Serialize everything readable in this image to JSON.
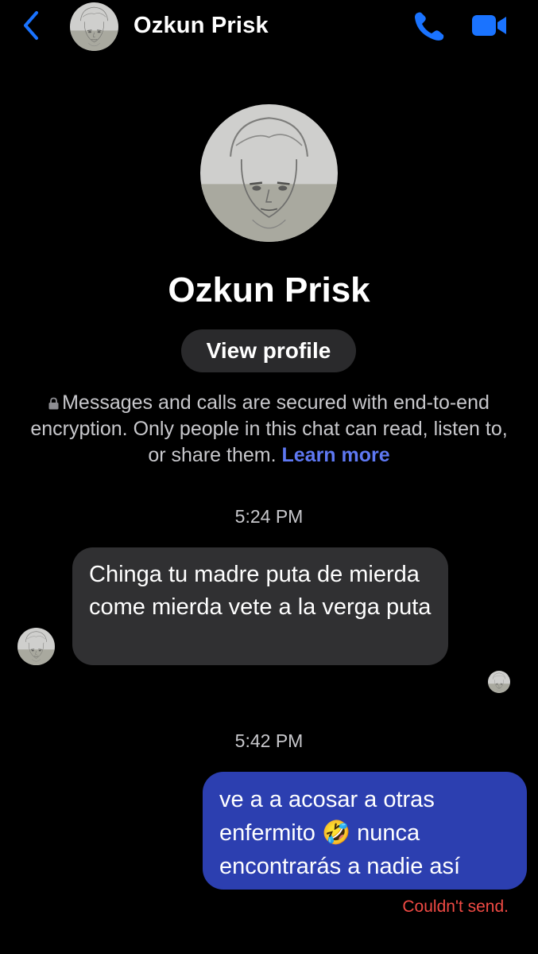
{
  "header": {
    "contact_name": "Ozkun Prisk",
    "back_icon": "chevron-left-icon",
    "call_icon": "phone-icon",
    "video_icon": "video-camera-icon",
    "accent_color": "#1a73ff"
  },
  "profile": {
    "name": "Ozkun Prisk",
    "view_profile_label": "View profile",
    "avatar_icon": "sketched-portrait-avatar"
  },
  "encryption_notice": {
    "lock_icon": "lock-icon",
    "text": "Messages and calls are secured with end-to-end encryption. Only people in this chat can read, listen to, or share them.",
    "link_label": "Learn more",
    "link_color": "#5e78f2"
  },
  "conversation": {
    "timestamps": [
      "5:24 PM",
      "5:42 PM"
    ],
    "messages": [
      {
        "direction": "incoming",
        "text": "Chinga tu madre puta de mierda come mierda vete a la verga puta",
        "bubble_color": "#303032"
      },
      {
        "direction": "outgoing",
        "text": "ve a a acosar a otras enfermito 🤣 nunca encontrarás a nadie así",
        "bubble_color": "#2c3fb0",
        "status": "Couldn't send.",
        "status_color": "#f04a44"
      }
    ]
  }
}
